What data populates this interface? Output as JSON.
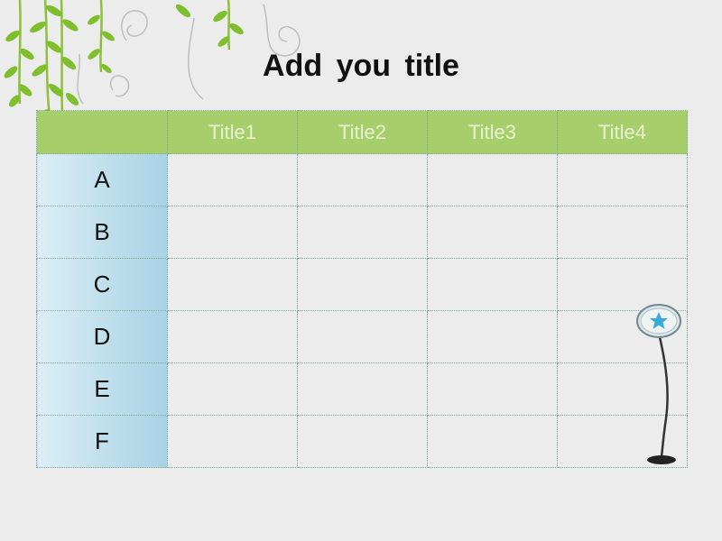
{
  "slide": {
    "title": "Add  you  title"
  },
  "table": {
    "columns": [
      "",
      "Title1",
      "Title2",
      "Title3",
      "Title4"
    ],
    "rows": [
      {
        "label": "A",
        "cells": [
          "",
          "",
          "",
          ""
        ]
      },
      {
        "label": "B",
        "cells": [
          "",
          "",
          "",
          ""
        ]
      },
      {
        "label": "C",
        "cells": [
          "",
          "",
          "",
          ""
        ]
      },
      {
        "label": "D",
        "cells": [
          "",
          "",
          "",
          ""
        ]
      },
      {
        "label": "E",
        "cells": [
          "",
          "",
          "",
          ""
        ]
      },
      {
        "label": "F",
        "cells": [
          "",
          "",
          "",
          ""
        ]
      }
    ]
  },
  "colors": {
    "header_green": "#a6cf6b",
    "row_label_blue": "#bfdeec",
    "grid_line": "#7fa899",
    "background": "#ececec",
    "star": "#3aa9d8"
  },
  "icons": [
    "vine-leaves-decoration",
    "swirl-decoration",
    "star-lamp-icon"
  ]
}
